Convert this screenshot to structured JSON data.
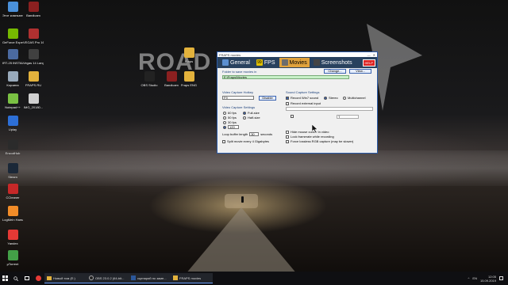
{
  "desktop": {
    "icons": [
      {
        "label": "Этот компьютер",
        "color": "#4a90d9"
      },
      {
        "label": "Bandicam",
        "color": "#8b2020"
      },
      {
        "label": "GeForce Experience",
        "color": "#76b900"
      },
      {
        "label": "VEGAS Pro 16.0",
        "color": "#b03030"
      },
      {
        "label": "IRT-25 INSTALL",
        "color": "#4b6aa0"
      },
      {
        "label": "Vegas 14 Langua...",
        "color": "#404040"
      },
      {
        "label": "Корзина",
        "color": "#9ab"
      },
      {
        "label": "FRAPS.RU",
        "color": "#e3b23c"
      },
      {
        "label": "Notepad++",
        "color": "#7ac143"
      },
      {
        "label": "IMG_20180...",
        "color": "#d0d0d0"
      },
      {
        "label": "Uplay",
        "color": "#2d6fd6"
      },
      {
        "label": "EncodHub",
        "color": "#2b2b2b"
      },
      {
        "label": "Steam",
        "color": "#1b2838"
      },
      {
        "label": "CCleaner",
        "color": "#c62828"
      },
      {
        "label": "LogMeIn Hamachi",
        "color": "#f28c28"
      },
      {
        "label": "Yandex",
        "color": "#e53935"
      },
      {
        "label": "μTorrent",
        "color": "#43a047"
      },
      {
        "label": "Fraps",
        "color": "#e3b23c"
      },
      {
        "label": "OBS Studio",
        "color": "#222222"
      },
      {
        "label": "Bandicam",
        "color": "#8b2020"
      },
      {
        "label": "Fraps ENG",
        "color": "#e3b23c"
      }
    ],
    "brand_text": "ROAD"
  },
  "fraps_window": {
    "title": "FRAPS movies",
    "controls": [
      "—",
      "✕"
    ],
    "tabs": [
      {
        "label": "General",
        "icon": "general-icon",
        "color": "#5b8fd0"
      },
      {
        "label": "FPS",
        "icon": "fps-icon",
        "color": "#e0c000",
        "badge": "99"
      },
      {
        "label": "Movies",
        "icon": "movies-icon",
        "color": "#6c6c6c"
      },
      {
        "label": "Screenshots",
        "icon": "screenshots-icon",
        "color": "#444444"
      }
    ],
    "active_tab": "Movies",
    "help_label": "HELP",
    "folder_label": "Folder to save movies in",
    "folder_value": "E:\\Fraps\\Movies",
    "change_btn": "Change...",
    "view_btn": "View...",
    "hotkey_label": "Video Capture Hotkey",
    "hotkey_value": "F9",
    "disable_btn": "Disable",
    "video_settings_label": "Video Capture Settings",
    "fps_options": [
      "60 fps",
      "50 fps",
      "30 fps"
    ],
    "size_options": [
      "Full-size",
      "Half-size"
    ],
    "custom_fps": "120",
    "loop_label": "Loop buffer length",
    "loop_value": "30",
    "loop_unit": "seconds",
    "split_label": "Split movie every 4 Gigabytes",
    "sound_label": "Sound Capture Settings",
    "record_sound": "Record Win7 sound",
    "stereo": "Stereo",
    "multichannel": "Multichannel",
    "record_external": "Record external input",
    "ext_field": "",
    "ext_key": "T",
    "hide_cursor": "Hide mouse cursor in video",
    "lock_framerate": "Lock framerate while recording",
    "force_lossless": "Force lossless RGB capture (may be slower)"
  },
  "taskbar": {
    "apps": [
      {
        "label": "Новый том (E:)",
        "color": "#e3b23c"
      },
      {
        "label": "OBS 23.0.2 (64-bit...",
        "color": "#222222"
      },
      {
        "label": "сценарий по заме...",
        "color": "#2b579a"
      },
      {
        "label": "FRAPS movies",
        "color": "#e3b23c"
      }
    ],
    "lang": "EN",
    "time": "12:05",
    "date": "15.09.2019"
  }
}
